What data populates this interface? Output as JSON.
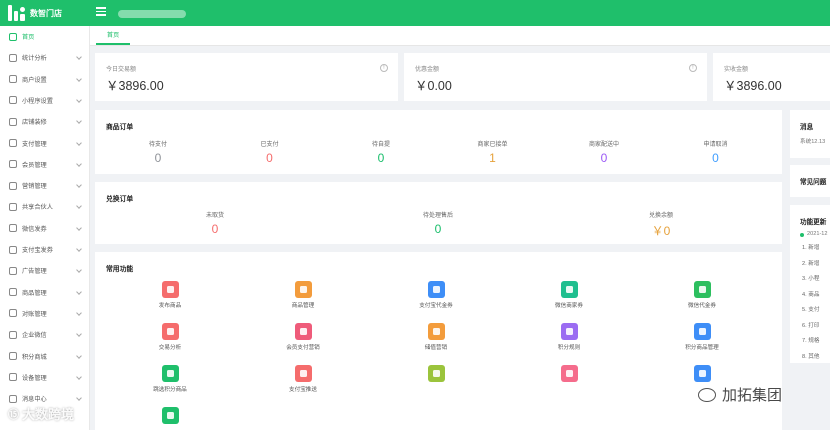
{
  "brand": {
    "name": "数智门店"
  },
  "sidebar": {
    "items": [
      {
        "label": "首页",
        "icon": "home-icon"
      },
      {
        "label": "统计分析",
        "icon": "bar-chart-icon"
      },
      {
        "label": "商户设置",
        "icon": "gear-icon"
      },
      {
        "label": "小程序设置",
        "icon": "mini-program-icon"
      },
      {
        "label": "店铺装修",
        "icon": "brush-icon"
      },
      {
        "label": "支付管理",
        "icon": "payment-icon"
      },
      {
        "label": "会员管理",
        "icon": "member-icon"
      },
      {
        "label": "营销管理",
        "icon": "marketing-icon"
      },
      {
        "label": "共享合伙人",
        "icon": "partner-icon"
      },
      {
        "label": "微信发券",
        "icon": "wechat-coupon-icon"
      },
      {
        "label": "支付宝发券",
        "icon": "alipay-coupon-icon"
      },
      {
        "label": "广告管理",
        "icon": "ad-icon"
      },
      {
        "label": "商品管理",
        "icon": "goods-icon"
      },
      {
        "label": "对账管理",
        "icon": "reconcile-icon"
      },
      {
        "label": "企业微信",
        "icon": "wecom-icon"
      },
      {
        "label": "积分商城",
        "icon": "points-mall-icon"
      },
      {
        "label": "设备管理",
        "icon": "device-icon"
      },
      {
        "label": "消息中心",
        "icon": "message-icon"
      }
    ]
  },
  "tabs": [
    {
      "label": "首页"
    }
  ],
  "stats": [
    {
      "label": "今日交易额",
      "value": "￥3896.00"
    },
    {
      "label": "优惠金额",
      "value": "￥0.00"
    },
    {
      "label": "实收金额",
      "value": "￥3896.00"
    }
  ],
  "goods_orders": {
    "title": "商品订单",
    "items": [
      {
        "label": "待支付",
        "value": "0",
        "color": "#909399"
      },
      {
        "label": "已支付",
        "value": "0",
        "color": "#f56c6c"
      },
      {
        "label": "待自提",
        "value": "0",
        "color": "#19be6b"
      },
      {
        "label": "商家已接单",
        "value": "1",
        "color": "#e6a23c"
      },
      {
        "label": "商家配送中",
        "value": "0",
        "color": "#9b59f6"
      },
      {
        "label": "申请取消",
        "value": "0",
        "color": "#409eff"
      }
    ]
  },
  "exchange_orders": {
    "title": "兑换订单",
    "items": [
      {
        "label": "未取货",
        "value": "0",
        "color": "#f56c6c"
      },
      {
        "label": "待处理售后",
        "value": "0",
        "color": "#19be6b"
      },
      {
        "label": "兑换余额",
        "value": "￥0",
        "color": "#e6a23c"
      }
    ]
  },
  "functions": {
    "title": "常用功能",
    "items": [
      {
        "label": "发布商品",
        "icon": "publish-goods-icon",
        "color": "#f56c6c"
      },
      {
        "label": "商品管理",
        "icon": "goods-manage-icon",
        "color": "#f39c3c"
      },
      {
        "label": "支付宝代金券",
        "icon": "alipay-voucher-icon",
        "color": "#3e8ef7"
      },
      {
        "label": "微信商家券",
        "icon": "wechat-merchant-coupon-icon",
        "color": "#1fbf8f"
      },
      {
        "label": "微信代金券",
        "icon": "wechat-voucher-icon",
        "color": "#2dbf5f"
      },
      {
        "label": "交易分析",
        "icon": "trade-analysis-icon",
        "color": "#f56c6c"
      },
      {
        "label": "会员支付营销",
        "icon": "member-pay-marketing-icon",
        "color": "#ef5b7a"
      },
      {
        "label": "储值营销",
        "icon": "stored-value-icon",
        "color": "#f39c3c"
      },
      {
        "label": "积分规则",
        "icon": "points-rule-icon",
        "color": "#9b6cf2"
      },
      {
        "label": "积分商品管理",
        "icon": "points-goods-icon",
        "color": "#3e8ef7"
      },
      {
        "label": "跳选积分商品",
        "icon": "select-points-goods-icon",
        "color": "#1fbf6b"
      },
      {
        "label": "支付宝推送",
        "icon": "alipay-push-icon",
        "color": "#f56c6c"
      },
      {
        "label": "",
        "icon": "wechat-push-icon",
        "color": "#9bc43c"
      },
      {
        "label": "",
        "icon": "coupon-icon",
        "color": "#f56c8c"
      },
      {
        "label": "",
        "icon": "device-icon",
        "color": "#3e8ef7"
      },
      {
        "label": "",
        "icon": "points-order-icon",
        "color": "#1fbf6b"
      }
    ]
  },
  "messages": {
    "title": "消息",
    "text": "系统12.13"
  },
  "faq": {
    "title": "常见问题"
  },
  "updates": {
    "title": "功能更新",
    "date": "2021-12",
    "lines": [
      "1. 新增",
      "2. 新增",
      "3. 小程",
      "4. 商品",
      "5. 支付",
      "6. 打印",
      "7. 规格",
      "8. 其他"
    ]
  },
  "watermarks": {
    "left": "大数跨境",
    "right": "加拓集团"
  }
}
